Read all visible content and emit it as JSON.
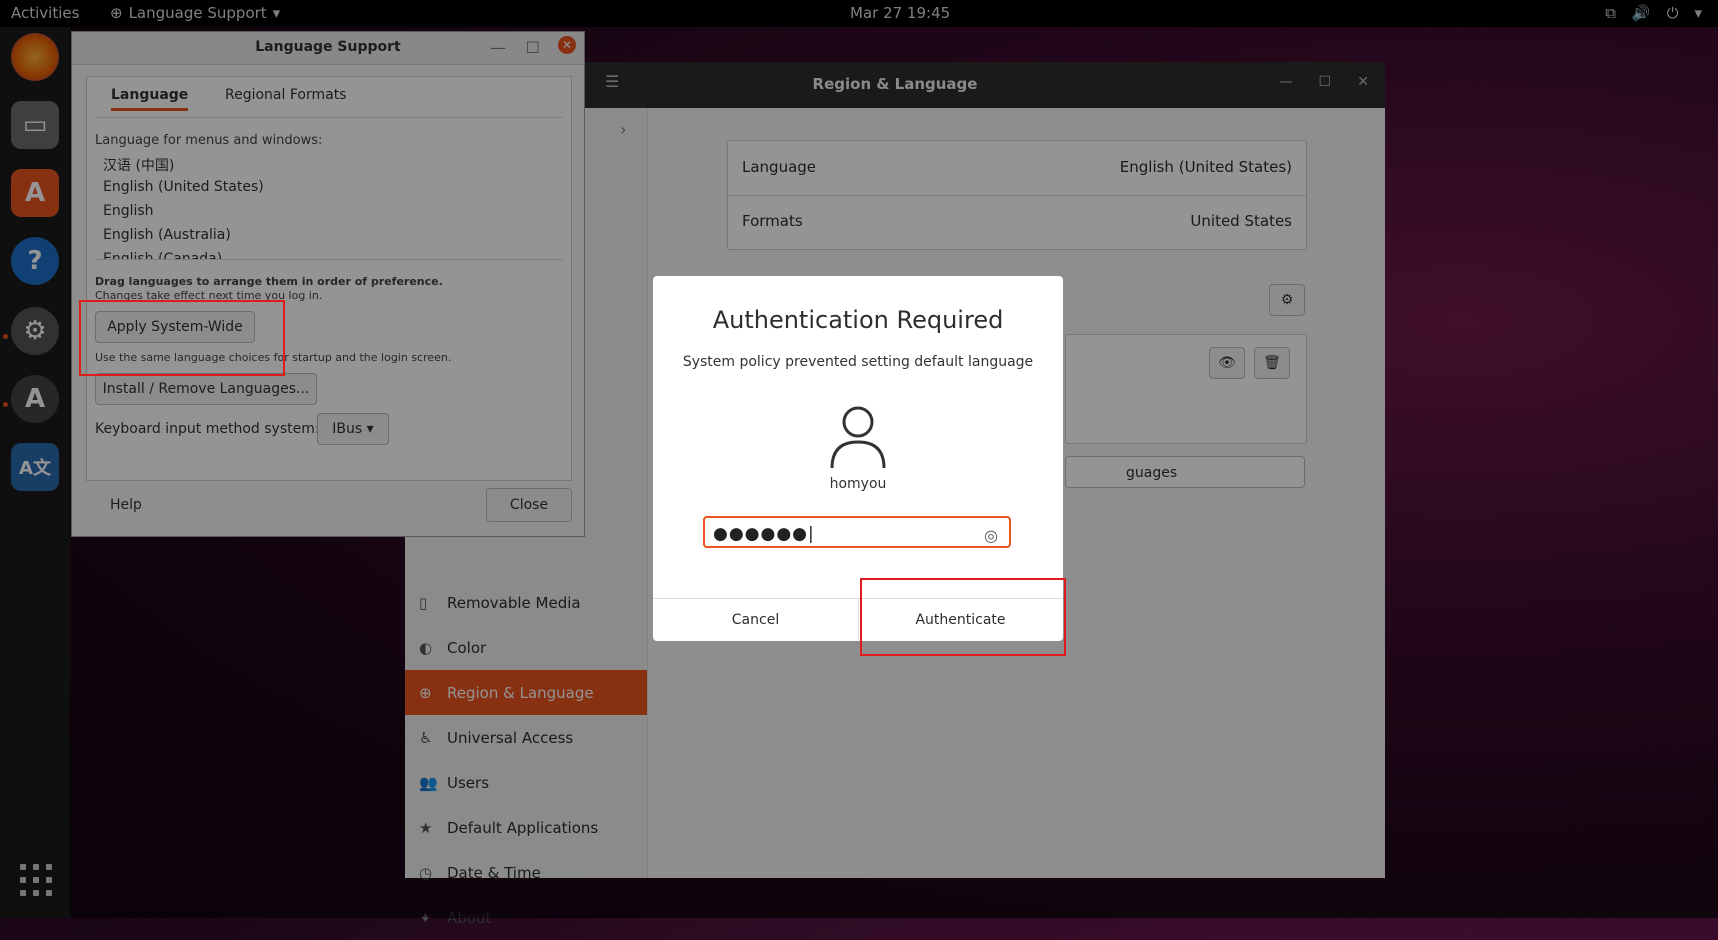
{
  "topbar": {
    "activities": "Activities",
    "app_menu": "Language Support",
    "clock": "Mar 27  19:45"
  },
  "settings": {
    "title": "Region & Language",
    "language_label": "Language",
    "language_value": "English (United States)",
    "formats_label": "Formats",
    "formats_value": "United States",
    "manage_fragment": "guages",
    "sidebar": [
      {
        "label": "Removable Media",
        "icon": "removable-media-icon"
      },
      {
        "label": "Color",
        "icon": "color-icon"
      },
      {
        "label": "Region & Language",
        "icon": "globe-icon"
      },
      {
        "label": "Universal Access",
        "icon": "accessibility-icon"
      },
      {
        "label": "Users",
        "icon": "users-icon"
      },
      {
        "label": "Default Applications",
        "icon": "star-icon"
      },
      {
        "label": "Date & Time",
        "icon": "clock-icon"
      },
      {
        "label": "About",
        "icon": "about-icon"
      }
    ]
  },
  "langsupport": {
    "title": "Language Support",
    "tabs": [
      "Language",
      "Regional Formats"
    ],
    "menus_label": "Language for menus and windows:",
    "languages": [
      "汉语 (中国)",
      "English (United States)",
      "English",
      "English (Australia)",
      "English (Canada)"
    ],
    "drag_hint": "Drag languages to arrange them in order of preference.",
    "changes_hint": "Changes take effect next time you log in.",
    "apply_button": "Apply System-Wide",
    "same_hint": "Use the same language choices for startup and the login screen.",
    "install_button": "Install / Remove Languages...",
    "keyboard_label": "Keyboard input method system:",
    "keyboard_value": "IBus",
    "help": "Help",
    "close": "Close"
  },
  "auth": {
    "title": "Authentication Required",
    "message": "System policy prevented setting default language",
    "username": "homyou",
    "password_mask": "●●●●●●",
    "cancel": "Cancel",
    "authenticate": "Authenticate"
  },
  "colors": {
    "accent": "#e95420",
    "highlight": "#e01b1b"
  }
}
